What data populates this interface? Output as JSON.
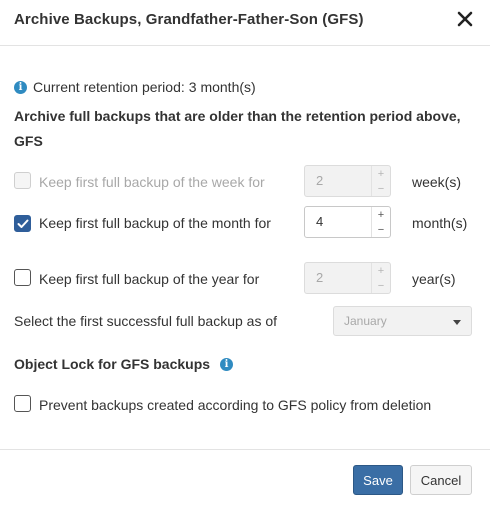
{
  "dialog": {
    "title": "Archive Backups, Grandfather-Father-Son (GFS)",
    "close_icon": "close-icon"
  },
  "retention": {
    "label": "Current retention period:",
    "value": "3 month(s)",
    "icon": "info-icon"
  },
  "section_heading": "Archive full backups that are older than the retention period above, GFS",
  "options": [
    {
      "label": "Keep first full backup of the week for",
      "checked": false,
      "disabled": true,
      "value": "2",
      "unit": "week(s)"
    },
    {
      "label": "Keep first full backup of the month for",
      "checked": true,
      "disabled": false,
      "value": "4",
      "unit": "month(s)"
    },
    {
      "label": "Keep first full backup of the year for",
      "checked": false,
      "disabled": false,
      "value": "2",
      "unit": "year(s)"
    }
  ],
  "stepper_glyphs": {
    "up": "+",
    "down": "−"
  },
  "first_backup": {
    "label": "Select the first successful full backup as of",
    "selected": "January",
    "disabled": true
  },
  "object_lock": {
    "title": "Object Lock for GFS backups",
    "option_label": "Prevent backups created according to GFS policy from deletion",
    "checked": false
  },
  "footer": {
    "save_label": "Save",
    "cancel_label": "Cancel"
  },
  "colors": {
    "primary": "#3a6ea5",
    "checkbox_checked": "#2f5e9a",
    "info_icon": "#2f8bc1",
    "text": "#333333",
    "disabled_text": "#a8a8a8"
  }
}
